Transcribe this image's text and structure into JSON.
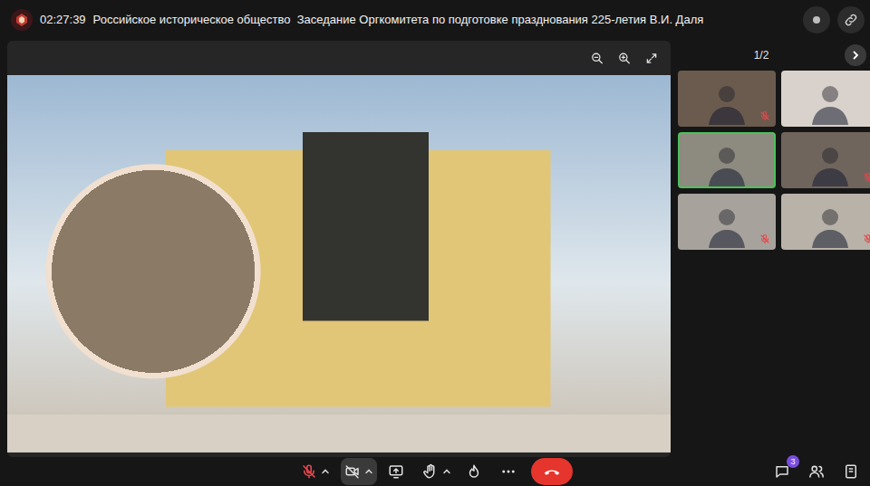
{
  "header": {
    "time": "02:27:39",
    "title": "Российское историческое общество  Заседание Оргкомитета по подготовке празднования 225-летия В.И. Даля"
  },
  "participants": {
    "page": "1/2",
    "tiles": [
      {
        "muted": true,
        "selected": false
      },
      {
        "muted": false,
        "selected": false
      },
      {
        "muted": false,
        "selected": true
      },
      {
        "muted": true,
        "selected": false
      },
      {
        "muted": true,
        "selected": false
      },
      {
        "muted": true,
        "selected": false
      }
    ]
  },
  "controls": {
    "mic_muted": true,
    "camera_off": true
  },
  "side_buttons": {
    "chat_badge": "3"
  }
}
